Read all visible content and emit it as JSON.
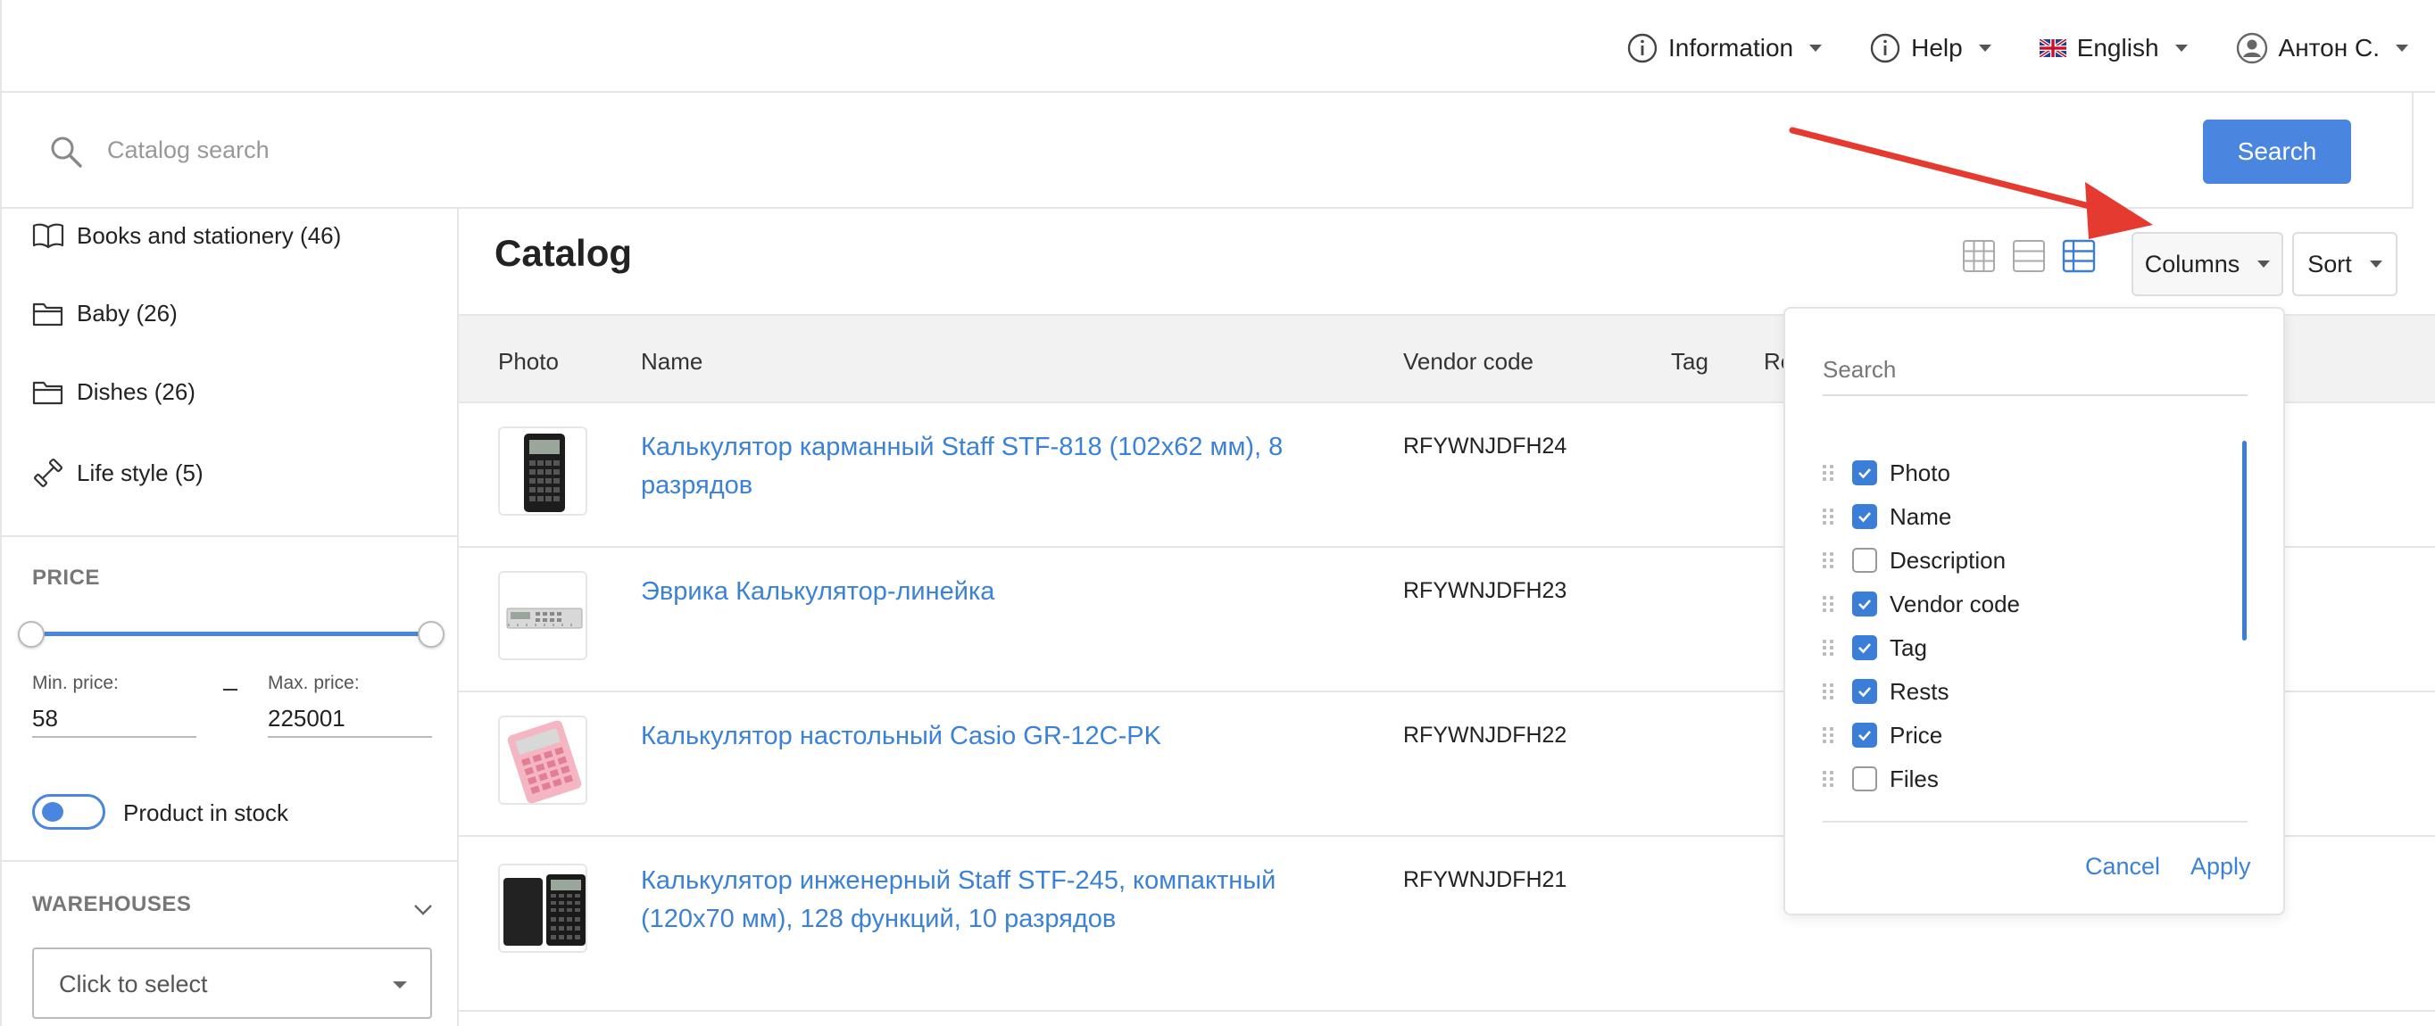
{
  "topnav": {
    "information": "Information",
    "help": "Help",
    "language": "English",
    "user": "Антон С."
  },
  "search": {
    "placeholder": "Catalog search",
    "button": "Search"
  },
  "sidebar": {
    "categories": [
      {
        "label": "Books and stationery (46)",
        "icon": "book-icon"
      },
      {
        "label": "Baby (26)",
        "icon": "folder-icon"
      },
      {
        "label": "Dishes (26)",
        "icon": "folder-icon"
      },
      {
        "label": "Life style (5)",
        "icon": "dumbbell-icon"
      }
    ],
    "price": {
      "title": "PRICE",
      "min_label": "Min. price:",
      "max_label": "Max. price:",
      "min_value": "58",
      "max_value": "225001"
    },
    "in_stock_label": "Product in stock",
    "warehouses": {
      "title": "WAREHOUSES",
      "select_placeholder": "Click to select"
    }
  },
  "main": {
    "title": "Catalog",
    "columns_button": "Columns",
    "sort_button": "Sort",
    "headers": [
      "Photo",
      "Name",
      "Vendor code",
      "Tag",
      "Re"
    ],
    "rows": [
      {
        "name": "Калькулятор карманный Staff STF-818 (102х62 мм), 8 разрядов",
        "vendor_code": "RFYWNJDFH24"
      },
      {
        "name": "Эврика Калькулятор-линейка",
        "vendor_code": "RFYWNJDFH23"
      },
      {
        "name": "Калькулятор настольный Casio GR-12C-PK",
        "vendor_code": "RFYWNJDFH22"
      },
      {
        "name": "Калькулятор инженерный Staff STF-245, компактный (120х70 мм), 128 функций, 10 разрядов",
        "vendor_code": "RFYWNJDFH21"
      }
    ]
  },
  "columns_dropdown": {
    "search_placeholder": "Search",
    "options": [
      {
        "label": "Photo",
        "checked": true
      },
      {
        "label": "Name",
        "checked": true
      },
      {
        "label": "Description",
        "checked": false
      },
      {
        "label": "Vendor code",
        "checked": true
      },
      {
        "label": "Tag",
        "checked": true
      },
      {
        "label": "Rests",
        "checked": true
      },
      {
        "label": "Price",
        "checked": true
      },
      {
        "label": "Files",
        "checked": false
      }
    ],
    "cancel": "Cancel",
    "apply": "Apply"
  },
  "colors": {
    "accent": "#4a86e0",
    "link": "#3b82d6",
    "annotation_arrow": "#e53a2f"
  }
}
